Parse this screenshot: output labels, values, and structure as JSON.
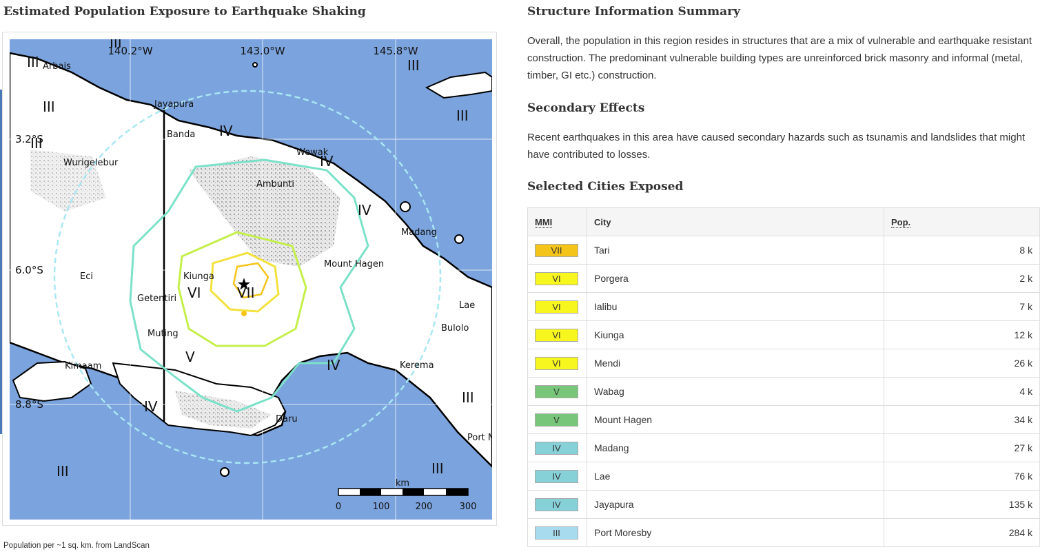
{
  "map_panel": {
    "title": "Estimated Population Exposure to Earthquake Shaking",
    "caption": "Population per ~1 sq. km. from LandScan",
    "lon_labels": [
      "140.2°W",
      "143.0°W",
      "145.8°W"
    ],
    "lat_labels": [
      "3.2°S",
      "6.0°S",
      "8.8°S"
    ],
    "cities": [
      "Arbais",
      "Jayapura",
      "Banda",
      "Wewak",
      "Wurigelebur",
      "Ambunti",
      "Madang",
      "Mount Hagen",
      "Eci",
      "Kiunga",
      "Getentiri",
      "Lae",
      "Bulolo",
      "Muting",
      "Kimaam",
      "Kerema",
      "Daru",
      "Port M"
    ],
    "intensity_labels": [
      "III",
      "III",
      "III",
      "III",
      "III",
      "IV",
      "IV",
      "IV",
      "VI",
      "VII",
      "V",
      "IV",
      "III",
      "III",
      "III",
      "III",
      "IV"
    ],
    "scale_unit": "km",
    "scale_ticks": [
      "0",
      "100",
      "200",
      "300"
    ],
    "colors": {
      "ocean": "#7ba3dd",
      "land": "#ffffff",
      "mmi_iii": "#a9e7f4",
      "mmi_iv": "#7be1c9",
      "mmi_v": "#c5ef4b",
      "mmi_vi": "#f3e23b",
      "mmi_vii": "#f5c419"
    }
  },
  "structure_summary": {
    "heading": "Structure Information Summary",
    "text": "Overall, the population in this region resides in structures that are a mix of vulnerable and earthquake resistant construction. The predominant vulnerable building types are unreinforced brick masonry and informal (metal, timber, GI etc.) construction."
  },
  "secondary_effects": {
    "heading": "Secondary Effects",
    "text": "Recent earthquakes in this area have caused secondary hazards such as tsunamis and landslides that might have contributed to losses."
  },
  "cities_exposed": {
    "heading": "Selected Cities Exposed",
    "columns": {
      "mmi": "MMI",
      "city": "City",
      "pop": "Pop."
    },
    "rows": [
      {
        "mmi": "VII",
        "city": "Tari",
        "pop": "8 k",
        "color": "#f5c419"
      },
      {
        "mmi": "VI",
        "city": "Porgera",
        "pop": "2 k",
        "color": "#f7f61f"
      },
      {
        "mmi": "VI",
        "city": "Ialibu",
        "pop": "7 k",
        "color": "#f7f61f"
      },
      {
        "mmi": "VI",
        "city": "Kiunga",
        "pop": "12 k",
        "color": "#f7f61f"
      },
      {
        "mmi": "VI",
        "city": "Mendi",
        "pop": "26 k",
        "color": "#f7f61f"
      },
      {
        "mmi": "V",
        "city": "Wabag",
        "pop": "4 k",
        "color": "#78c679"
      },
      {
        "mmi": "V",
        "city": "Mount Hagen",
        "pop": "34 k",
        "color": "#78c679"
      },
      {
        "mmi": "IV",
        "city": "Madang",
        "pop": "27 k",
        "color": "#86d1d8"
      },
      {
        "mmi": "IV",
        "city": "Lae",
        "pop": "76 k",
        "color": "#86d1d8"
      },
      {
        "mmi": "IV",
        "city": "Jayapura",
        "pop": "135 k",
        "color": "#86d1d8"
      },
      {
        "mmi": "III",
        "city": "Port Moresby",
        "pop": "284 k",
        "color": "#a9dbef"
      }
    ]
  }
}
